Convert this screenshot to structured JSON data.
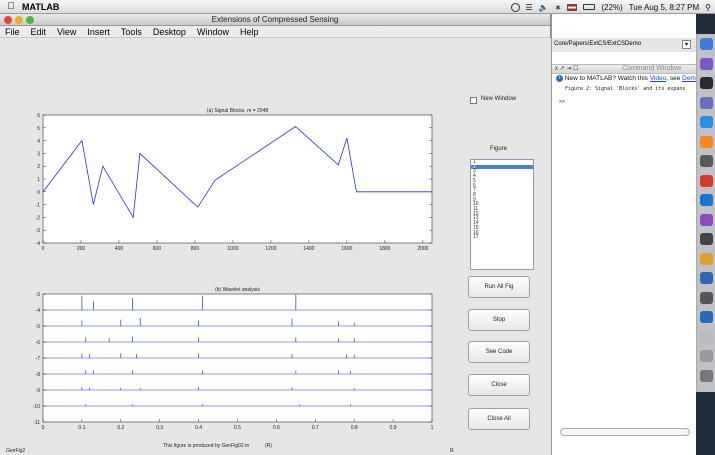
{
  "menubar": {
    "app": "MATLAB",
    "battery": "(22%)",
    "clock": "Tue Aug 5, 8:27 PM"
  },
  "figure": {
    "title": "Extensions of Compressed Sensing",
    "menus": [
      "File",
      "Edit",
      "View",
      "Insert",
      "Tools",
      "Desktop",
      "Window",
      "Help"
    ],
    "checkbox_label": "New Window",
    "figure_label": "Figure",
    "figure_list": [
      "1",
      "2",
      "3",
      "4",
      "5",
      "6",
      "7",
      "8",
      "9",
      "10",
      "11",
      "12",
      "13",
      "14",
      "15",
      "16",
      "17"
    ],
    "selected_index": 1,
    "buttons": [
      "Run All Fig",
      "Stop",
      "See Code",
      "Close",
      "Close All"
    ],
    "footer_left": "GenFig2",
    "footer_center": "This figure is produced by GenFig02.m",
    "footer_center_tag": "(R)",
    "footer_right": "R"
  },
  "chart_data": [
    {
      "type": "line",
      "title": "(a) Signal Blocks, m = 2048",
      "xlim": [
        0,
        2048
      ],
      "ylim": [
        -4,
        6
      ],
      "xticks": [
        0,
        200,
        400,
        600,
        800,
        1000,
        1200,
        1400,
        1600,
        1800,
        2000
      ],
      "yticks": [
        -4,
        -3,
        -2,
        -1,
        0,
        1,
        2,
        3,
        4,
        5,
        6
      ],
      "color": "#1f3bcc",
      "x": [
        0,
        205,
        205,
        265,
        265,
        315,
        315,
        475,
        475,
        510,
        510,
        815,
        815,
        905,
        905,
        1330,
        1330,
        1555,
        1555,
        1600,
        1600,
        1650,
        1650,
        2048
      ],
      "y": [
        0,
        4,
        4,
        -1,
        -1,
        2,
        2,
        -2,
        -2,
        3,
        3,
        -1.2,
        -1.2,
        0.9,
        0.9,
        5.1,
        5.1,
        2.1,
        2.1,
        4.2,
        4.2,
        0,
        0,
        0
      ]
    },
    {
      "type": "line",
      "title": "(b) Wavelet analysis",
      "xlim": [
        0,
        1
      ],
      "ylim": [
        -11,
        -3
      ],
      "xticks": [
        0,
        0.1,
        0.2,
        0.3,
        0.4,
        0.5,
        0.6,
        0.7,
        0.8,
        0.9,
        1
      ],
      "yticks": [
        -11,
        -10,
        -9,
        -8,
        -7,
        -6,
        -5,
        -4,
        -3
      ],
      "baselines": [
        -4,
        -5,
        -6,
        -7,
        -8,
        -9,
        -10
      ],
      "spikes": [
        {
          "level": -4,
          "x": [
            0.1,
            0.13,
            0.23,
            0.41,
            0.65
          ],
          "h": [
            0.9,
            0.55,
            0.75,
            0.9,
            0.95
          ]
        },
        {
          "level": -5,
          "x": [
            0.1,
            0.2,
            0.25,
            0.4,
            0.64,
            0.76,
            0.8
          ],
          "h": [
            0.35,
            0.4,
            0.5,
            0.35,
            0.45,
            0.3,
            0.2
          ]
        },
        {
          "level": -6,
          "x": [
            0.11,
            0.17,
            0.23,
            0.4,
            0.65,
            0.76,
            0.8
          ],
          "h": [
            0.3,
            0.25,
            0.35,
            0.3,
            0.3,
            0.2,
            0.25
          ]
        },
        {
          "level": -7,
          "x": [
            0.1,
            0.12,
            0.2,
            0.24,
            0.4,
            0.64,
            0.78,
            0.8
          ],
          "h": [
            0.3,
            0.25,
            0.3,
            0.25,
            0.3,
            0.25,
            0.2,
            0.2
          ]
        },
        {
          "level": -8,
          "x": [
            0.11,
            0.13,
            0.23,
            0.41,
            0.65,
            0.76,
            0.79
          ],
          "h": [
            0.22,
            0.2,
            0.22,
            0.2,
            0.2,
            0.22,
            0.18
          ]
        },
        {
          "level": -9,
          "x": [
            0.1,
            0.12,
            0.2,
            0.25,
            0.4,
            0.64,
            0.8
          ],
          "h": [
            0.18,
            0.15,
            0.15,
            0.12,
            0.18,
            0.16,
            0.12
          ]
        },
        {
          "level": -10,
          "x": [
            0.11,
            0.23,
            0.41,
            0.66,
            0.79
          ],
          "h": [
            0.12,
            0.1,
            0.12,
            0.1,
            0.1
          ]
        }
      ]
    }
  ],
  "command": {
    "path": "Core/Papers/ExtCS/ExtCSDemo",
    "window_title": "Command Window",
    "toolbar_controls": "x ↗ ⇥ ☐",
    "info_text": "New to MATLAB? Watch this ",
    "video_link": "Video",
    "info_sep": ", see ",
    "demo_link": "Dem",
    "output_line": "Figure 2: Signal 'Blocks' and its expans",
    "prompt": ">>"
  },
  "dock_colors": [
    "#3b7dd8",
    "#7a5ac8",
    "#2a2a2a",
    "#6c6cc0",
    "#2d8ee0",
    "#f08a1c",
    "#5a5a5a",
    "#d23a2a",
    "#1c73c8",
    "#8a4cc0",
    "#444444",
    "#e0a030",
    "#3366aa",
    "#555555",
    "#2a6ab0",
    "#bbbbbb",
    "#999999",
    "#777777"
  ]
}
